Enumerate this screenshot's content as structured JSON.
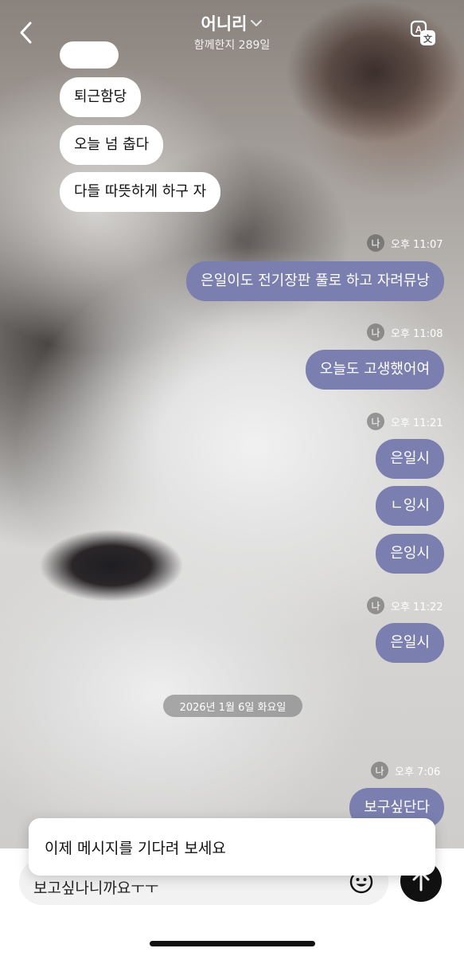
{
  "header": {
    "back_label": "<",
    "title": "어니리",
    "subtitle": "함께한지 289일"
  },
  "messages": [
    {
      "side": "in",
      "text": "퇴근함당"
    },
    {
      "side": "in",
      "text": "오늘 넘 춥다"
    },
    {
      "side": "in",
      "text": "다들 따뜻하게 하구 자"
    },
    {
      "side": "out",
      "text": "은일이도 전기장판 풀로 하고 자려뮤낭"
    },
    {
      "side": "out",
      "text": "오늘도 고생했어여"
    },
    {
      "side": "out",
      "text": "은일시"
    },
    {
      "side": "out",
      "text": "ㄴ잉시"
    },
    {
      "side": "out",
      "text": "은잉시"
    },
    {
      "side": "out",
      "text": "은일시"
    },
    {
      "side": "out",
      "text": "보구싶단다"
    }
  ],
  "meta": [
    {
      "badge": "나",
      "time": "오후 11:07"
    },
    {
      "badge": "나",
      "time": "오후 11:08"
    },
    {
      "badge": "나",
      "time": "오후 11:21"
    },
    {
      "badge": "나",
      "time": "오후 11:22"
    },
    {
      "badge": "나",
      "time": "오후 7:06"
    }
  ],
  "date_separator": "2026년 1월 6일 화요일",
  "composer": {
    "input_value": "보고싶나니까요ㅜㅜ"
  },
  "toast": {
    "text": "이제 메시지를 기다려 보세요"
  },
  "colors": {
    "outgoing_bubble": "#7b7fb0",
    "incoming_bubble": "#ffffff",
    "send_button": "#111111"
  }
}
